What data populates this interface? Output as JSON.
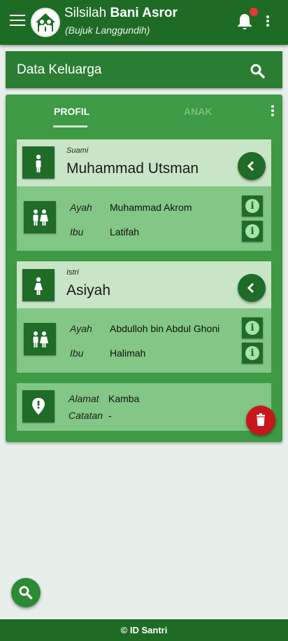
{
  "app": {
    "title_prefix": "Silsilah",
    "title_bold": "Bani Asror",
    "subtitle": "(Bujuk Langgundih)",
    "menu_icon": "hamburger-icon",
    "bell_icon": "bell-icon",
    "more_icon": "more-vert-icon"
  },
  "search": {
    "title": "Data Keluarga",
    "icon": "search-icon"
  },
  "tabs": [
    {
      "label": "PROFIL",
      "active": true
    },
    {
      "label": "ANAK",
      "active": false
    }
  ],
  "husband": {
    "role": "Suami",
    "name": "Muhammad Utsman",
    "father_label": "Ayah",
    "father": "Muhammad Akrom",
    "mother_label": "Ibu",
    "mother": "Latifah"
  },
  "wife": {
    "role": "Istri",
    "name": "Asiyah",
    "father_label": "Ayah",
    "father": "Abdulloh bin Abdul Ghoni",
    "mother_label": "Ibu",
    "mother": "Halimah"
  },
  "address": {
    "address_label": "Alamat",
    "address": "Kamba",
    "note_label": "Catatan",
    "note": "-"
  },
  "footer": "© ID Santri",
  "colors": {
    "appbar": "#1e6b26",
    "card": "#3e9a44",
    "panel": "#82c785",
    "header_panel": "#c9e5c8",
    "delete": "#c8161d",
    "notification": "#e53935"
  }
}
